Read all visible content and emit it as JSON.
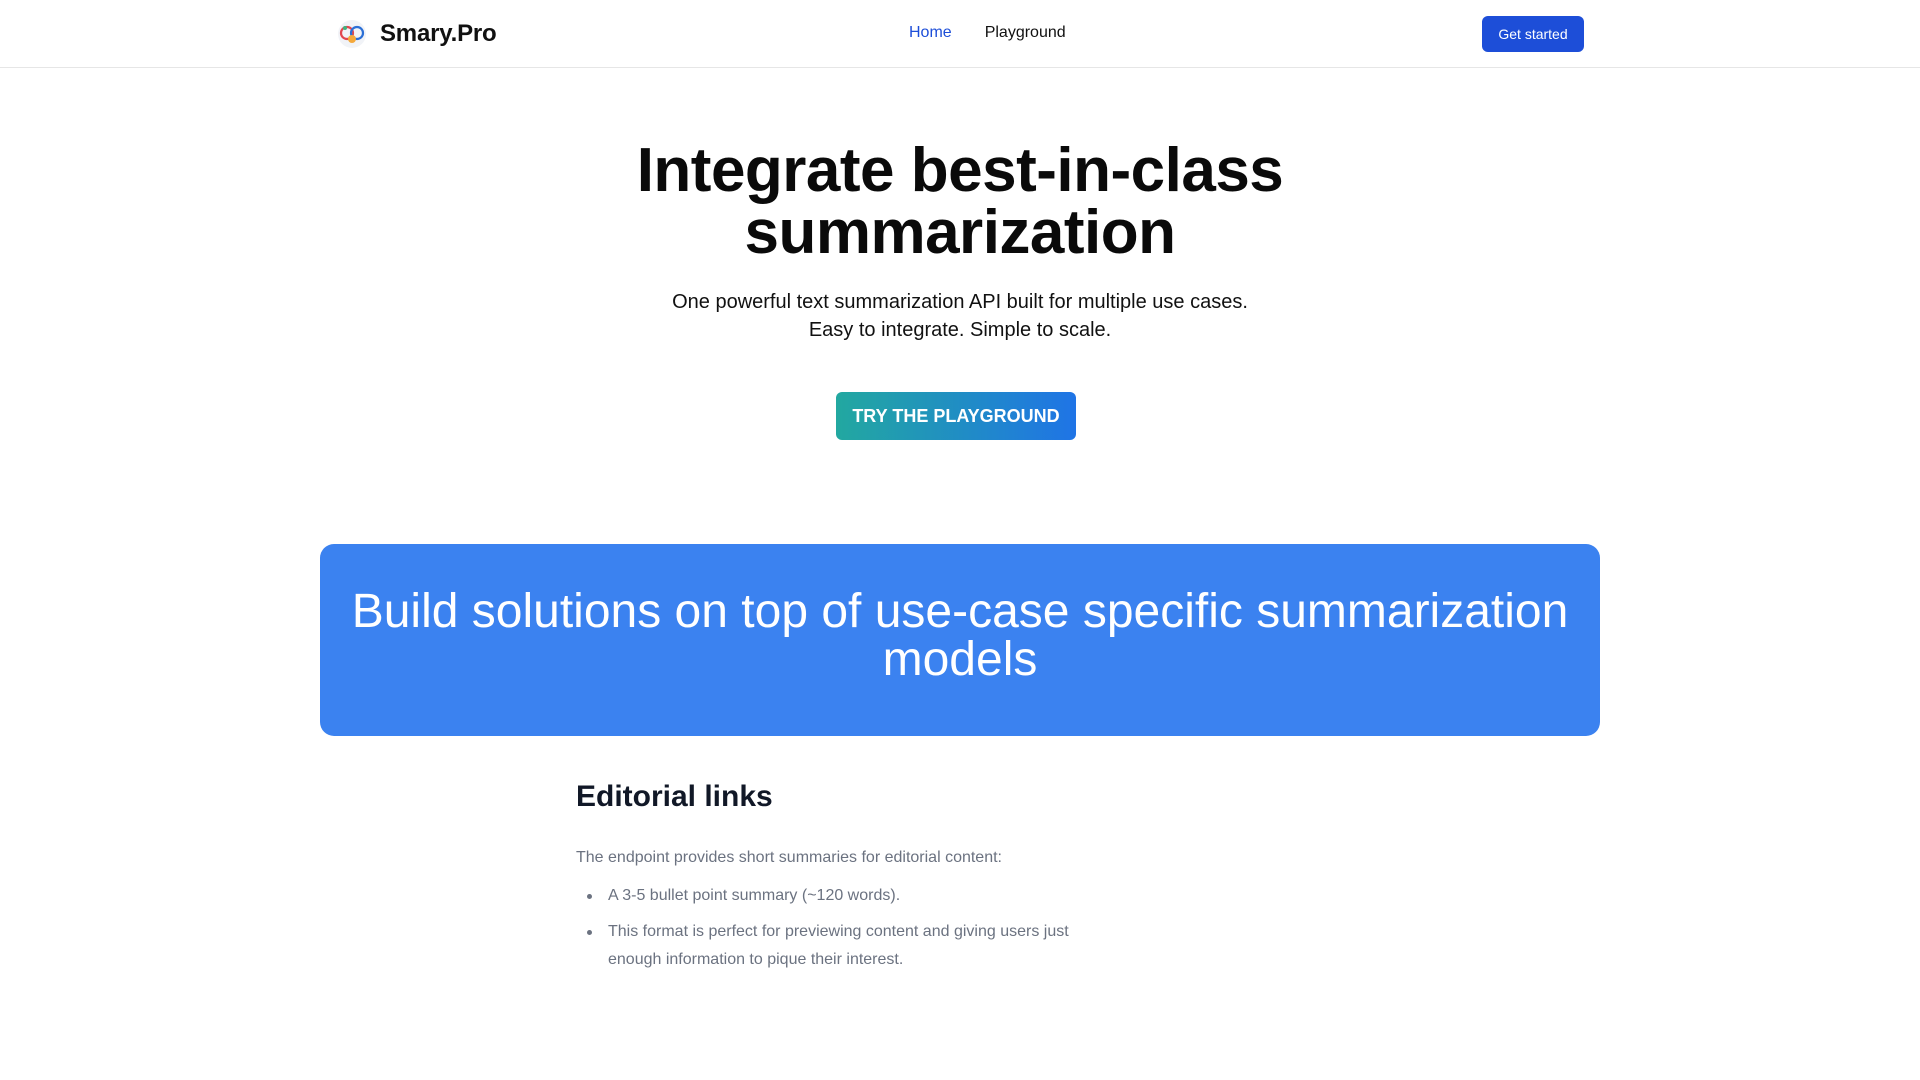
{
  "header": {
    "brand_name": "Smary.Pro",
    "nav": [
      {
        "label": "Home",
        "active": true
      },
      {
        "label": "Playground",
        "active": false
      }
    ],
    "cta_label": "Get started"
  },
  "hero": {
    "title": "Integrate best-in-class summarization",
    "subtitle_line1": "One powerful text summarization API built for multiple use cases.",
    "subtitle_line2": "Easy to integrate. Simple to scale.",
    "button_label": "TRY THE PLAYGROUND"
  },
  "banner": {
    "title": "Build solutions on top of use-case specific summarization models"
  },
  "section": {
    "title": "Editorial links",
    "description": "The endpoint provides short summaries for editorial content:",
    "items": [
      "A 3-5 bullet point summary (~120 words).",
      "This format is perfect for previewing content and giving users just enough information to pique their interest."
    ]
  },
  "colors": {
    "primary": "#1d4ed8",
    "banner": "#3b82f0",
    "gradient_start": "#22a8a0",
    "gradient_end": "#1f74e6",
    "muted_text": "#6b7280"
  },
  "icons": {
    "logo": "smary-logo-icon",
    "bullet": "bullet-dot-icon"
  }
}
